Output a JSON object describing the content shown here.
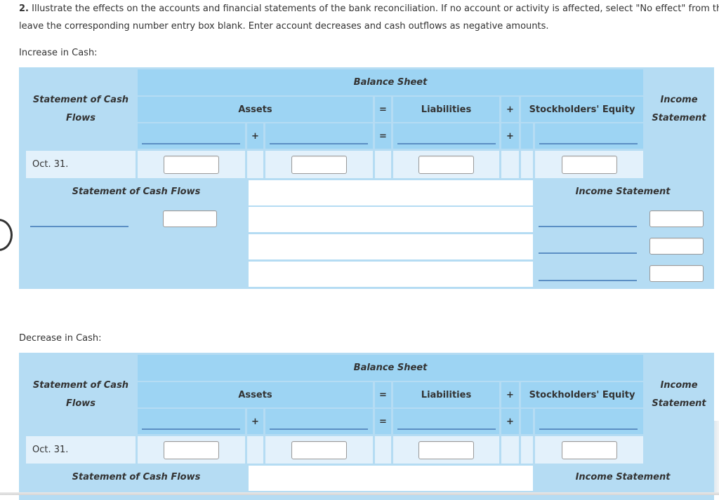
{
  "instructions": {
    "number": "2.",
    "line1": "Illustrate the effects on the accounts and financial statements of the bank reconciliation. If no account or activity is affected, select \"No effect\" from th",
    "line2": "leave the corresponding number entry box blank. Enter account decreases and cash outflows as negative amounts."
  },
  "colors": {
    "panel": "#b5dcf3",
    "header": "#9dd4f3",
    "row_light": "#e3f1fb",
    "underline": "#5b8fc4"
  },
  "tables": [
    {
      "section_label": "Increase in Cash:",
      "header": {
        "scf": "Statement of Cash Flows",
        "scf_line1": "Statement of Cash",
        "scf_line2": "Flows",
        "balance_sheet": "Balance Sheet",
        "assets": "Assets",
        "equals": "=",
        "liabilities": "Liabilities",
        "plus": "+",
        "stockholders_equity": "Stockholders' Equity",
        "is_line1": "Income",
        "is_line2": "Statement"
      },
      "subheader": {
        "plus1": "+",
        "equals": "=",
        "plus2": "+"
      },
      "row": {
        "date": "Oct. 31.",
        "scf_value": "",
        "asset1_value": "",
        "asset2_value": "",
        "liabilities_value": "",
        "se_value": ""
      },
      "lower": {
        "scf_title": "Statement of Cash Flows",
        "is_title": "Income Statement",
        "scf_select": "",
        "scf_value": "",
        "is_rows": [
          {
            "select": "",
            "value": ""
          },
          {
            "select": "",
            "value": ""
          },
          {
            "select": "",
            "value": ""
          }
        ]
      }
    },
    {
      "section_label": "Decrease in Cash:",
      "header": {
        "scf_line1": "Statement of Cash",
        "scf_line2": "Flows",
        "balance_sheet": "Balance Sheet",
        "assets": "Assets",
        "equals": "=",
        "liabilities": "Liabilities",
        "plus": "+",
        "stockholders_equity": "Stockholders' Equity",
        "is_line1": "Income",
        "is_line2": "Statement"
      },
      "subheader": {
        "plus1": "+",
        "equals": "=",
        "plus2": "+"
      },
      "row": {
        "date": "Oct. 31.",
        "scf_value": "",
        "asset1_value": "",
        "asset2_value": "",
        "liabilities_value": "",
        "se_value": ""
      },
      "lower": {
        "scf_title": "Statement of Cash Flows",
        "is_title": "Income Statement"
      }
    }
  ]
}
